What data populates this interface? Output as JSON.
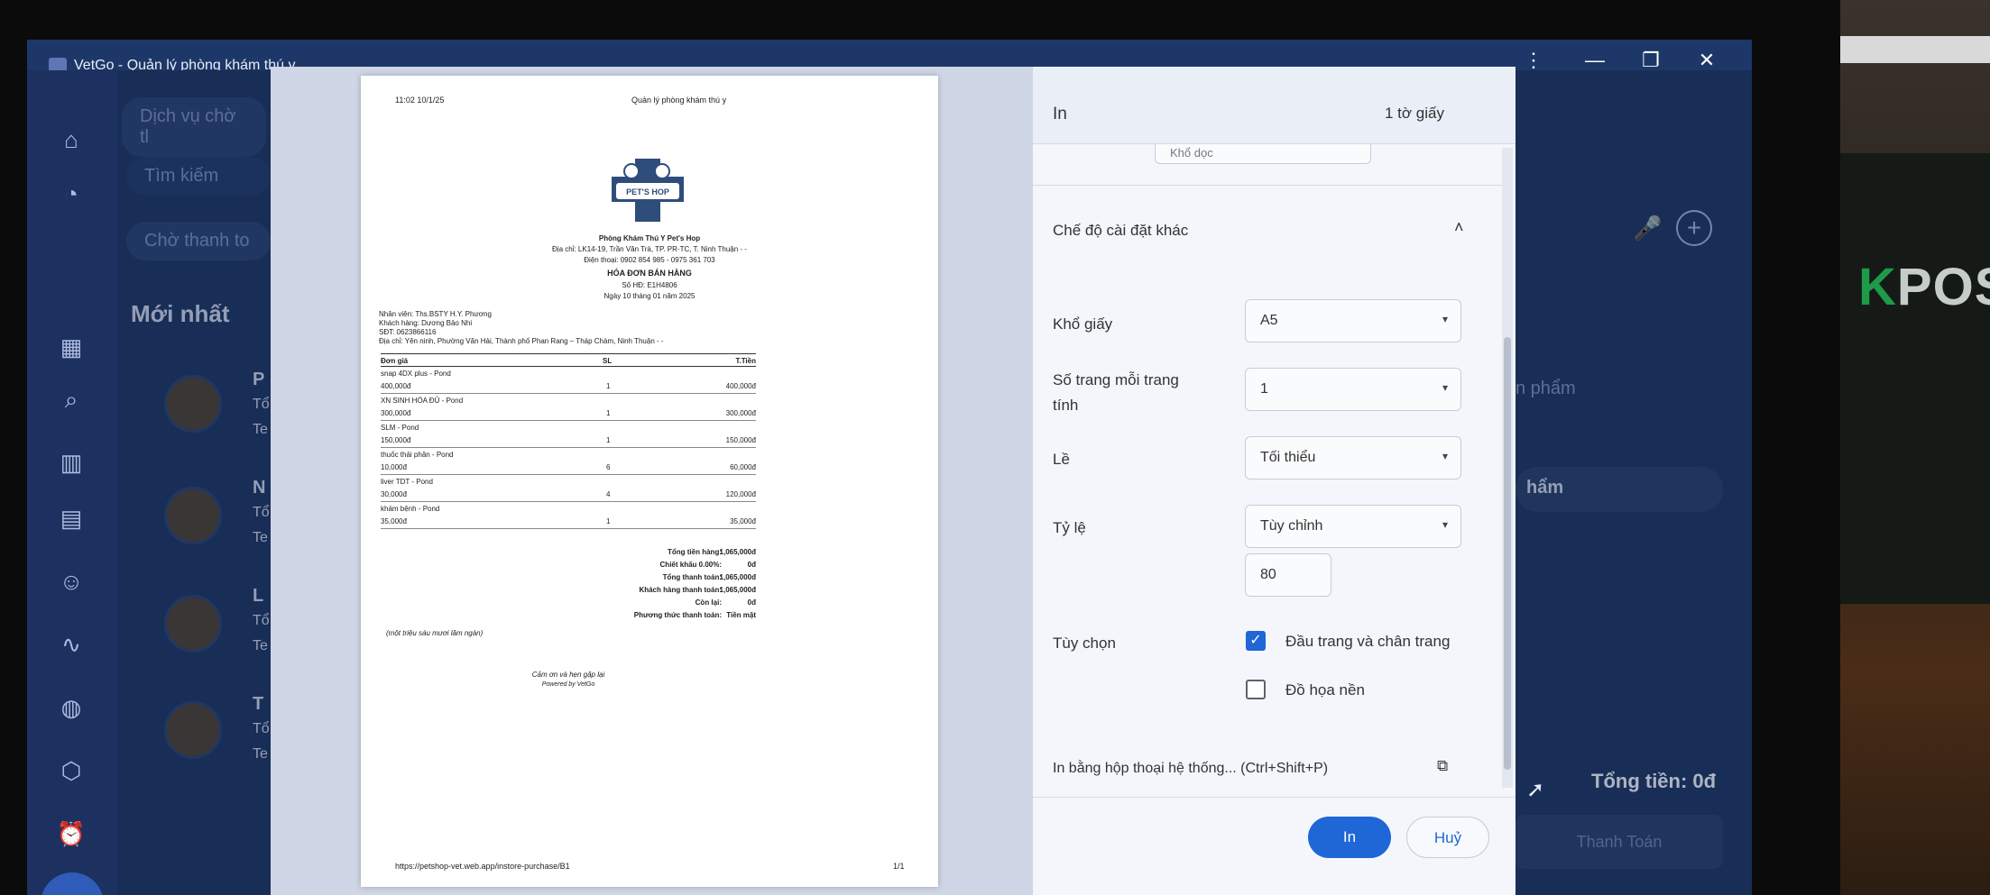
{
  "window": {
    "title": "VetGo - Quản lý phòng khám thú y",
    "more_label": "⋮",
    "minimize_label": "—",
    "restore_label": "❐",
    "close_label": "✕"
  },
  "background": {
    "service_tab": "Dịch vụ chờ tl",
    "search_placeholder": "Tìm kiếm",
    "filter_pill": "Chờ thanh to",
    "section_title": "Mới nhất",
    "list_initials": [
      "P",
      "N",
      "L",
      "T"
    ],
    "list_sub": [
      "Tổ",
      "Tổ",
      "Tổ",
      "Tổ"
    ],
    "list_sub2": [
      "Te",
      "Te",
      "Te",
      "Te"
    ],
    "product_hint": "n phẩm",
    "product_hint2": "hẩm",
    "total_label": "Tổng tiền: 0đ",
    "pay_label": "Thanh Toán"
  },
  "receipt": {
    "time": "11:02 10/1/25",
    "header_title": "Quản lý phòng khám thú y",
    "logo_text": "PET'S HOP",
    "clinic_name": "Phòng Khám Thú Y Pet's Hop",
    "address": "Địa chỉ: LK14-19, Trần Văn Trà, TP. PR-TC, T. Ninh Thuận - -",
    "phone": "Điện thoại: 0902 854 985 - 0975 361 703",
    "doc_title": "HÓA ĐƠN BÁN HÀNG",
    "invoice_no": "Số HĐ: E1H4806",
    "date": "Ngày 10 tháng 01 năm 2025",
    "staff": "Nhân viên: Ths.BSTY H.Y. Phương",
    "customer": "Khách hàng: Dương Bảo Nhi",
    "customer_phone": "SĐT: 0623866116",
    "customer_address": "Địa chỉ: Yên ninh, Phường Văn Hải, Thành phố Phan Rang – Tháp Chàm, Ninh Thuận - -",
    "col_price": "Đơn giá",
    "col_qty": "SL",
    "col_total": "T.Tiền",
    "items": [
      {
        "name": "snap 4DX plus - Pond",
        "price": "400,000đ",
        "qty": "1",
        "total": "400,000đ"
      },
      {
        "name": "XN SINH HÓA ĐỦ - Pond",
        "price": "300,000đ",
        "qty": "1",
        "total": "300,000đ"
      },
      {
        "name": "SLM - Pond",
        "price": "150,000đ",
        "qty": "1",
        "total": "150,000đ"
      },
      {
        "name": "thuốc thải phân - Pond",
        "price": "10,000đ",
        "qty": "6",
        "total": "60,000đ"
      },
      {
        "name": "liver TDT - Pond",
        "price": "30,000đ",
        "qty": "4",
        "total": "120,000đ"
      },
      {
        "name": "khám bệnh - Pond",
        "price": "35,000đ",
        "qty": "1",
        "total": "35,000đ"
      }
    ],
    "summary": [
      {
        "label": "Tổng tiền hàng:",
        "value": "1,065,000đ"
      },
      {
        "label": "Chiết khấu 0.00%:",
        "value": "0đ"
      },
      {
        "label": "Tổng thanh toán:",
        "value": "1,065,000đ"
      },
      {
        "label": "Khách hàng thanh toán:",
        "value": "1,065,000đ"
      },
      {
        "label": "Còn lại:",
        "value": "0đ"
      },
      {
        "label": "Phương thức thanh toán:",
        "value": "Tiền mặt"
      }
    ],
    "amount_words": "(một triệu sáu mươi lăm ngàn)",
    "thanks": "Cảm ơn và hẹn gặp lại",
    "powered": "Powered by VetGo",
    "footer_url": "https://petshop-vet.web.app/instore-purchase/B1",
    "footer_page": "1/1"
  },
  "print": {
    "title": "In",
    "sheet_count": "1 tờ giấy",
    "partial_select": "Khổ dọc",
    "more_settings": "Chế độ cài đặt khác",
    "paper_size_label": "Khổ giấy",
    "paper_size_value": "A5",
    "pages_per_sheet_label_1": "Số trang mỗi trang",
    "pages_per_sheet_label_2": "tính",
    "pages_per_sheet_value": "1",
    "margins_label": "Lề",
    "margins_value": "Tối thiểu",
    "scale_label": "Tỷ lệ",
    "scale_value": "Tùy chỉnh",
    "scale_number": "80",
    "options_label": "Tùy chọn",
    "option_headers": "Đầu trang và chân trang",
    "option_headers_checked": true,
    "option_background": "Đồ họa nền",
    "option_background_checked": false,
    "system_dialog": "In bằng hộp thoại hệ thống... (Ctrl+Shift+P)",
    "print_button": "In",
    "cancel_button": "Huỷ"
  },
  "hardware": {
    "brand_k": "K",
    "brand_rest": "POS"
  },
  "colors": {
    "accent": "#1f66d6",
    "window_bg": "#1f3a6d",
    "dialog_bg": "#f4f6fb"
  }
}
